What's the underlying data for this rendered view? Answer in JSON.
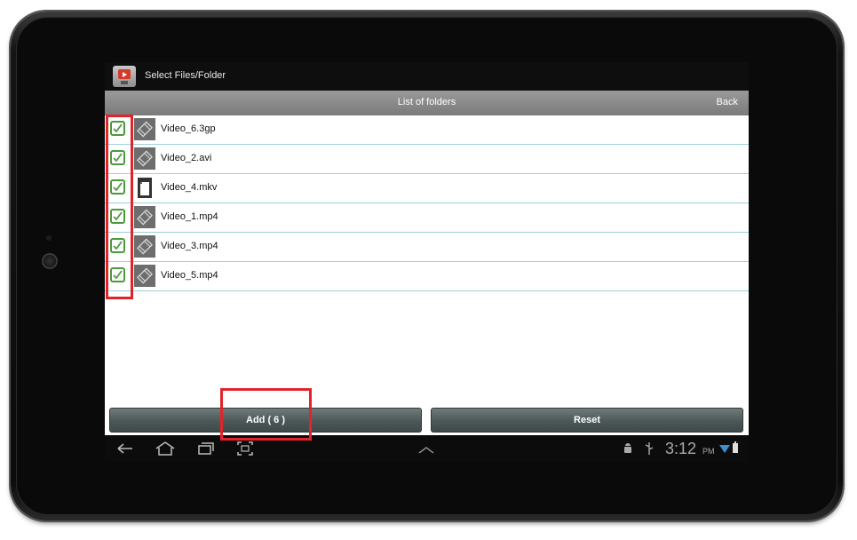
{
  "app": {
    "title": "Select Files/Folder"
  },
  "header": {
    "title": "List of folders",
    "back_label": "Back"
  },
  "files": [
    {
      "name": "Video_6.3gp",
      "icon": "video-icon",
      "checked": true
    },
    {
      "name": "Video_2.avi",
      "icon": "video-icon",
      "checked": true
    },
    {
      "name": "Video_4.mkv",
      "icon": "file-icon",
      "checked": true
    },
    {
      "name": "Video_1.mp4",
      "icon": "video-icon",
      "checked": true
    },
    {
      "name": "Video_3.mp4",
      "icon": "video-icon",
      "checked": true
    },
    {
      "name": "Video_5.mp4",
      "icon": "video-icon",
      "checked": true
    }
  ],
  "buttons": {
    "add_label": "Add ( 6 )",
    "reset_label": "Reset"
  },
  "status": {
    "time": "3:12",
    "ampm": "PM"
  },
  "colors": {
    "accent_check": "#4a9a3c",
    "annotation": "#e2242a",
    "divider": "#9fd0da"
  }
}
